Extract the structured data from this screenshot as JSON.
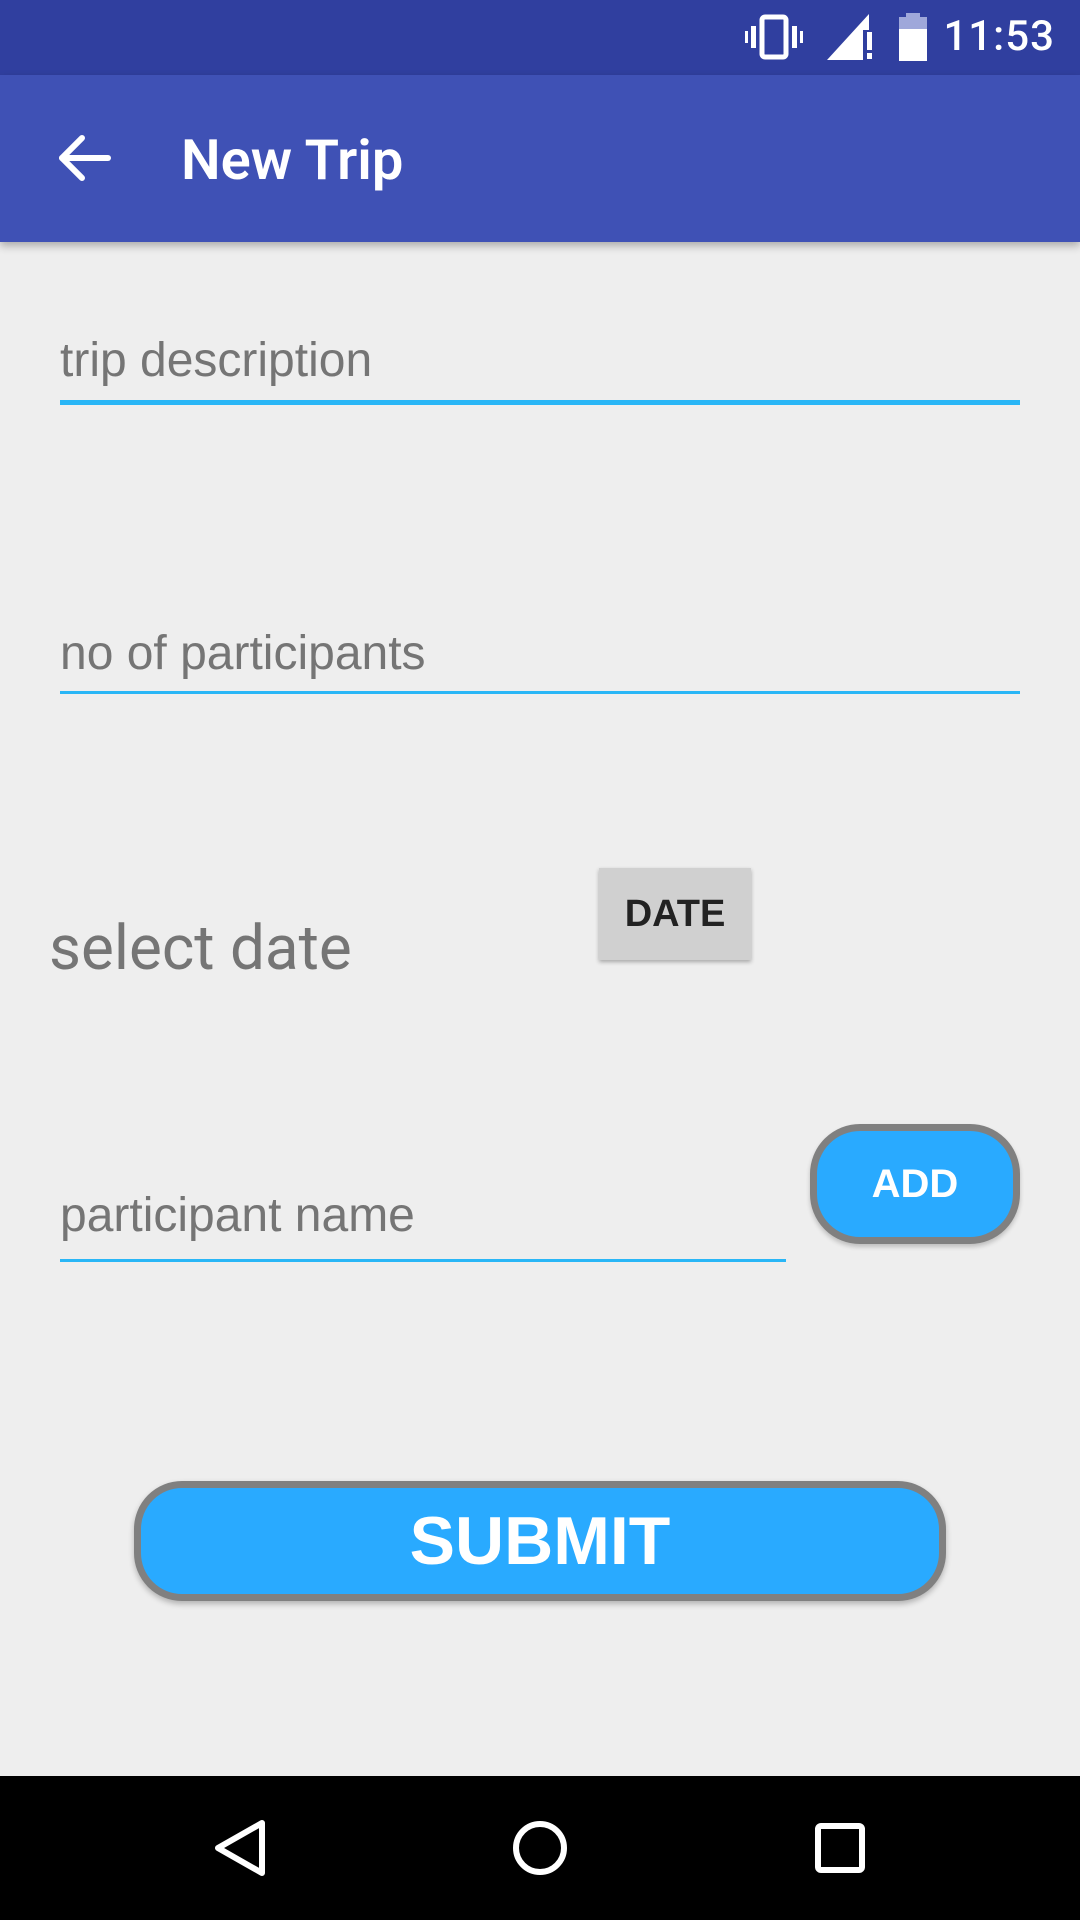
{
  "status_bar": {
    "time": "11:53",
    "icons": [
      "vibrate-icon",
      "signal-icon",
      "battery-icon"
    ]
  },
  "app_bar": {
    "title": "New Trip",
    "back_icon": "arrow-back-icon",
    "color": "#3f51b5"
  },
  "form": {
    "trip_description": {
      "placeholder": "trip description",
      "value": ""
    },
    "participants_count": {
      "placeholder": "no of participants",
      "value": ""
    },
    "select_date_label": "select date",
    "date_button_label": "DATE",
    "participant_name": {
      "placeholder": "participant name",
      "value": ""
    },
    "add_button_label": "ADD",
    "submit_button_label": "SUBMIT"
  },
  "nav_bar": {
    "icons": [
      "back-triangle-icon",
      "home-circle-icon",
      "recents-square-icon"
    ]
  },
  "colors": {
    "status_bar": "#303f9f",
    "accent": "#29b6f6",
    "button": "#29aaff",
    "background": "#eeeeee"
  }
}
